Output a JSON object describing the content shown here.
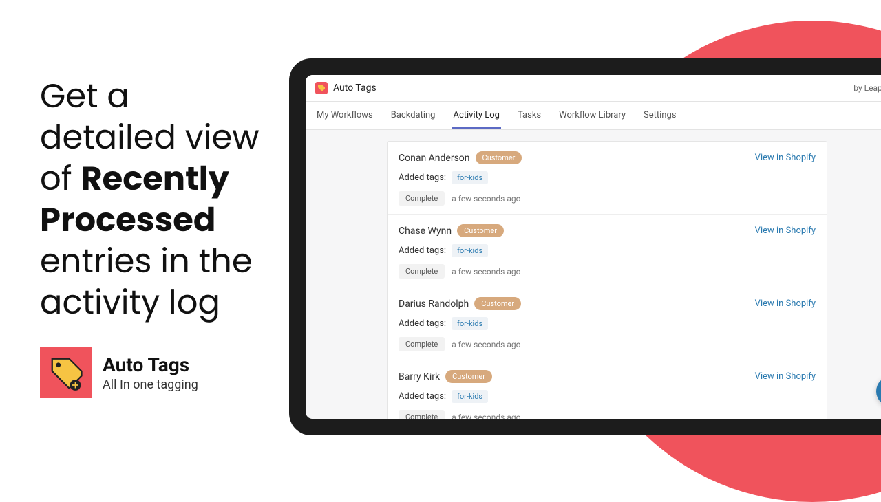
{
  "headline": {
    "part1": "Get a detailed view of ",
    "bold": "Recently Processed",
    "part2": " entries in the activity log"
  },
  "app": {
    "name": "Auto Tags",
    "tagline": "All In one tagging"
  },
  "appbar": {
    "title": "Auto Tags",
    "by": "by Leap App"
  },
  "tabs": [
    {
      "label": "My Workflows",
      "active": false
    },
    {
      "label": "Backdating",
      "active": false
    },
    {
      "label": "Activity Log",
      "active": true
    },
    {
      "label": "Tasks",
      "active": false
    },
    {
      "label": "Workflow Library",
      "active": false
    },
    {
      "label": "Settings",
      "active": false
    }
  ],
  "common": {
    "customerBadge": "Customer",
    "viewLink": "View in Shopify",
    "addedTagsLabel": "Added tags:",
    "completeStatus": "Complete",
    "timeAgo": "a few seconds ago"
  },
  "entries": [
    {
      "name": "Conan Anderson",
      "tag": "for-kids"
    },
    {
      "name": "Chase Wynn",
      "tag": "for-kids"
    },
    {
      "name": "Darius Randolph",
      "tag": "for-kids"
    },
    {
      "name": "Barry Kirk",
      "tag": "for-kids"
    }
  ]
}
